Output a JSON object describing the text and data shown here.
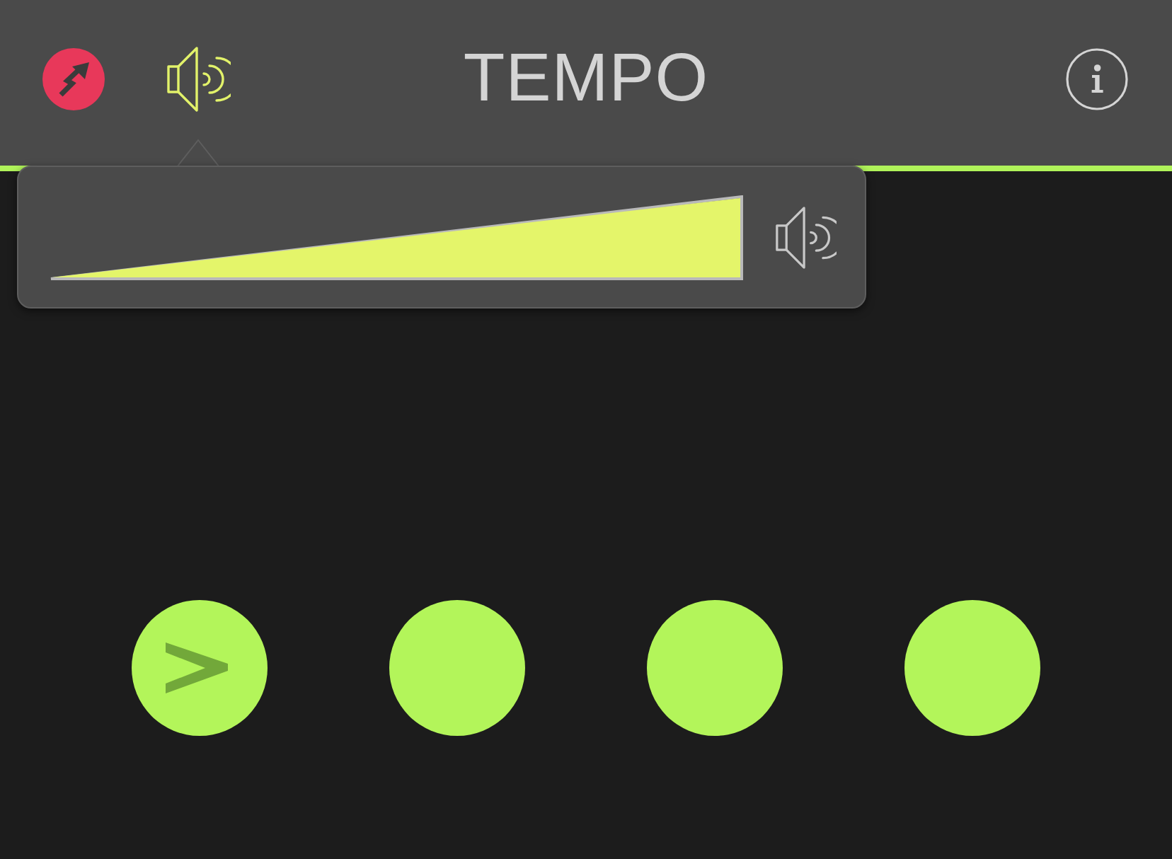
{
  "header": {
    "title": "TEMPO",
    "volume_button": {
      "selected": true
    }
  },
  "volume_popover": {
    "open": true,
    "level": 1
  },
  "beats": [
    {
      "accent": true
    },
    {
      "accent": false
    },
    {
      "accent": false
    },
    {
      "accent": false
    }
  ]
}
